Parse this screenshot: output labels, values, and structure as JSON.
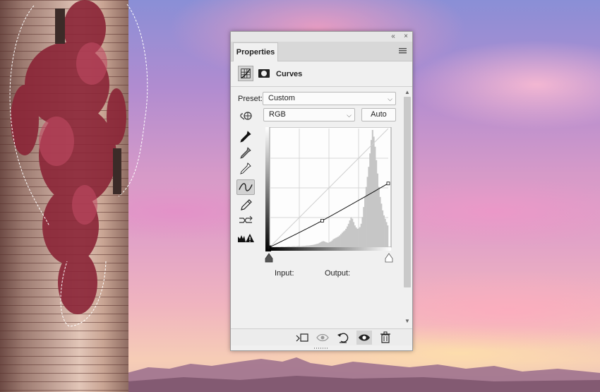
{
  "panel": {
    "collapse_glyph": "«",
    "close_glyph": "×",
    "tab_label": "Properties",
    "panel_menu_icon": "hamburger-menu-icon",
    "adjustment_title": "Curves",
    "header_icons": [
      "curves-grid-icon",
      "mask-icon"
    ]
  },
  "controls": {
    "preset_label": "Preset:",
    "preset_value": "Custom",
    "channel_value": "RGB",
    "auto_label": "Auto",
    "input_label": "Input:",
    "output_label": "Output:",
    "chevron_glyph": "⌵"
  },
  "tools": [
    "target-adjust-icon",
    "black-eyedropper-icon",
    "gray-eyedropper-icon",
    "white-eyedropper-icon",
    "curve-points-icon",
    "pencil-icon",
    "smooth-curve-icon",
    "clipping-warning-icon"
  ],
  "footer_icons": [
    "clip-to-layer-icon",
    "view-previous-icon",
    "reset-icon",
    "visibility-eye-icon",
    "trash-icon"
  ],
  "curve": {
    "points": [
      [
        0,
        0
      ],
      [
        113,
        57
      ],
      [
        255,
        137
      ]
    ]
  },
  "histogram": [
    2,
    1,
    1,
    2,
    2,
    3,
    3,
    2,
    3,
    4,
    4,
    3,
    4,
    4,
    5,
    5,
    4,
    5,
    6,
    6,
    5,
    6,
    7,
    7,
    6,
    7,
    8,
    8,
    9,
    10,
    10,
    11,
    12,
    13,
    14,
    16,
    18,
    20,
    22,
    26,
    30,
    34,
    36,
    34,
    30,
    28,
    26,
    30,
    34,
    40,
    48,
    52,
    56,
    60,
    64,
    70,
    78,
    86,
    94,
    100,
    110,
    124,
    140,
    160,
    178,
    170,
    150,
    130,
    118,
    110,
    112,
    120,
    140,
    180,
    240,
    300,
    360,
    420,
    480,
    560,
    640,
    700,
    660,
    600,
    520,
    440,
    360,
    300,
    260,
    220,
    190,
    170,
    150,
    130
  ]
}
